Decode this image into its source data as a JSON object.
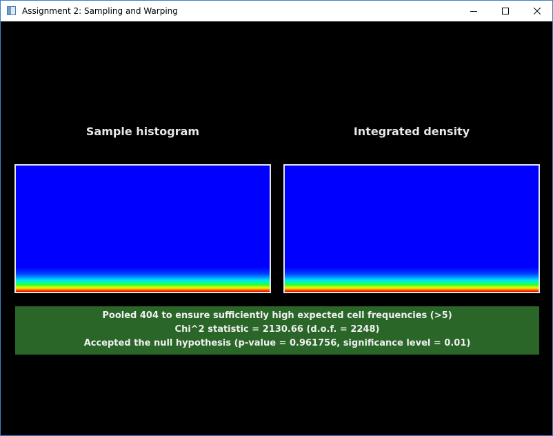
{
  "window": {
    "title": "Assignment 2: Sampling and Warping",
    "controls": [
      "minimize",
      "maximize",
      "close"
    ]
  },
  "panels": {
    "left_title": "Sample histogram",
    "right_title": "Integrated density",
    "colormap": "jet",
    "left_icon": "heatmap",
    "right_icon": "heatmap"
  },
  "result": {
    "line1": "Pooled 404 to ensure sufficiently high expected cell frequencies (>5)",
    "line2": "Chi^2 statistic = 2130.66 (d.o.f. = 2248)",
    "line3": "Accepted the null hypothesis (p-value = 0.961756, significance level = 0.01)",
    "background_color": "#2a6628"
  }
}
